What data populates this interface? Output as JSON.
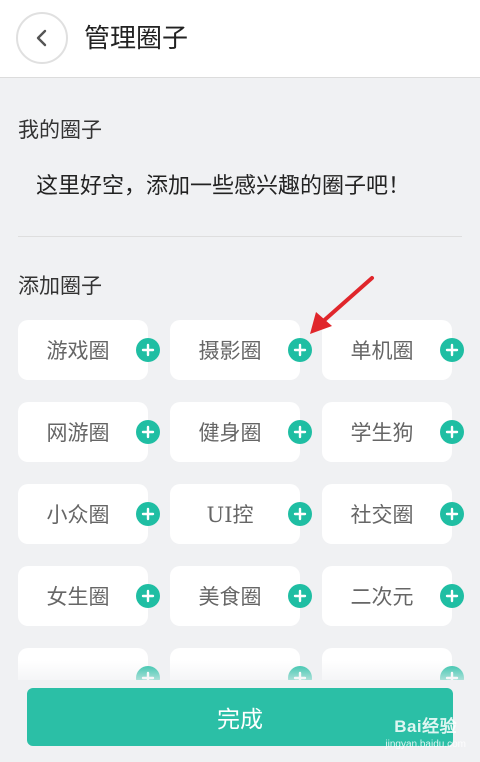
{
  "header": {
    "title": "管理圈子"
  },
  "my_circles": {
    "title": "我的圈子",
    "empty_text": "这里好空，添加一些感兴趣的圈子吧！"
  },
  "add_circles": {
    "title": "添加圈子",
    "items": [
      {
        "label": "游戏圈"
      },
      {
        "label": "摄影圈"
      },
      {
        "label": "单机圈"
      },
      {
        "label": "网游圈"
      },
      {
        "label": "健身圈"
      },
      {
        "label": "学生狗"
      },
      {
        "label": "小众圈"
      },
      {
        "label": "UI控"
      },
      {
        "label": "社交圈"
      },
      {
        "label": "女生圈"
      },
      {
        "label": "美食圈"
      },
      {
        "label": "二次元"
      },
      {
        "label": ""
      },
      {
        "label": ""
      },
      {
        "label": ""
      }
    ]
  },
  "footer": {
    "done_label": "完成"
  },
  "watermark": {
    "brand": "Bai经验",
    "url": "jingyan.baidu.com"
  },
  "colors": {
    "accent": "#2bbfa6",
    "add_icon": "#1fbea3",
    "arrow": "#e0262b",
    "background": "#f0f1f3"
  },
  "icons": {
    "back": "chevron-left-icon",
    "add": "plus-circle-icon",
    "annotation": "red-arrow"
  }
}
